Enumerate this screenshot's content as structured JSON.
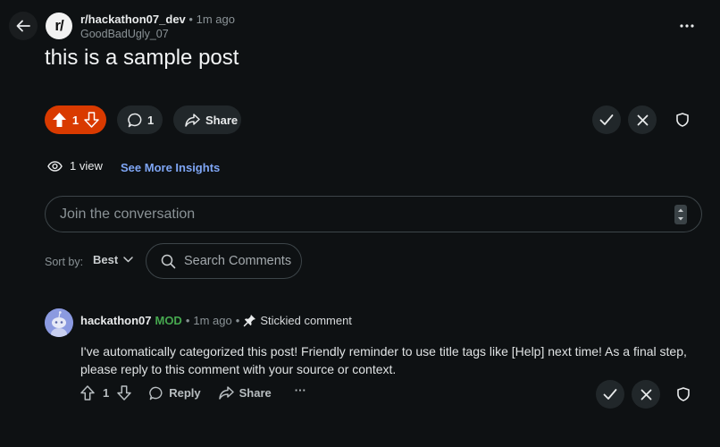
{
  "header": {
    "subreddit_logo_text": "r/",
    "subreddit": "r/hackathon07_dev",
    "separator": "•",
    "time_ago": "1m ago",
    "author": "GoodBadUgly_07"
  },
  "post": {
    "title": "this is a sample post",
    "score": "1",
    "comment_count": "1",
    "share_label": "Share",
    "views": "1 view",
    "insights_label": "See More Insights"
  },
  "composer": {
    "placeholder": "Join the conversation"
  },
  "sort": {
    "label": "Sort by:",
    "value": "Best"
  },
  "search": {
    "placeholder": "Search Comments"
  },
  "comment": {
    "username": "hackathon07",
    "mod_badge": "MOD",
    "separator": "•",
    "time_ago": "1m ago",
    "separator2": "•",
    "sticky_label": "Stickied comment",
    "body": "I've automatically categorized this post! Friendly reminder to use title tags like [Help] next time! As a final step, please reply to this comment with your source or context.",
    "score": "1",
    "reply_label": "Reply",
    "share_label": "Share",
    "more_label": "···"
  },
  "colors": {
    "background": "#0e1113",
    "upvote_active": "#d93a00",
    "pill": "#21272a",
    "link": "#7fa6f5",
    "mod": "#46a84f"
  },
  "icons": [
    "back-arrow-icon",
    "overflow-menu-icon",
    "upvote-icon",
    "downvote-icon",
    "comment-bubble-icon",
    "share-arrow-icon",
    "check-icon",
    "close-icon",
    "shield-icon",
    "eye-icon",
    "chevron-down-icon",
    "search-icon",
    "pin-icon",
    "snoo-avatar-icon"
  ]
}
